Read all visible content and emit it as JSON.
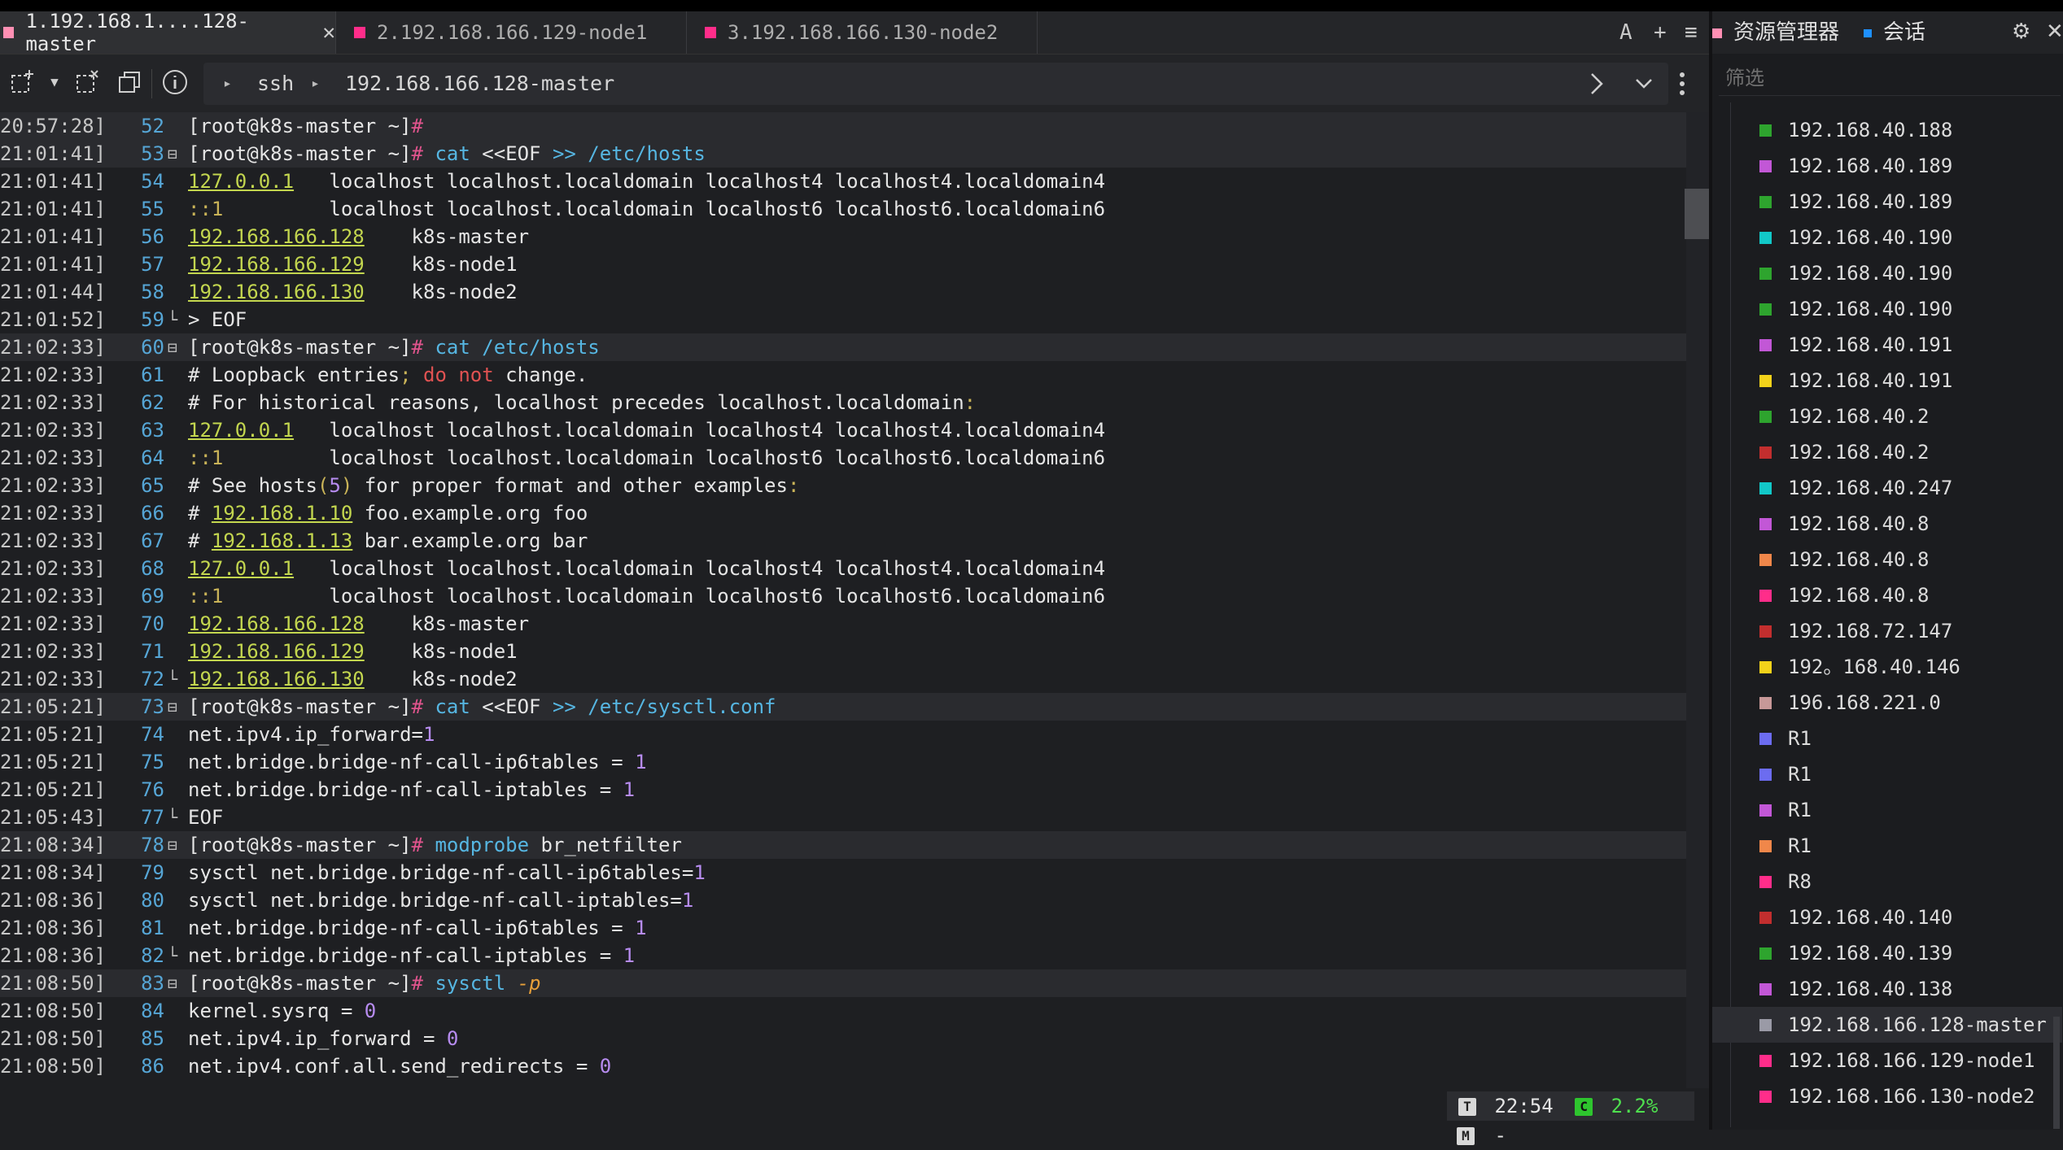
{
  "tabs": [
    {
      "label": "1.192.168.1....128-master",
      "color": "#ff8fb3",
      "active": true
    },
    {
      "label": "2.192.168.166.129-node1",
      "color": "#ff2d8a",
      "active": false
    },
    {
      "label": "3.192.168.166.130-node2",
      "color": "#ff2d8a",
      "active": false
    }
  ],
  "tabbar_tools": {
    "font": "A",
    "add": "+",
    "menu": "≡"
  },
  "breadcrumb": {
    "protocol": "ssh",
    "host": "192.168.166.128-master"
  },
  "terminal_lines": [
    {
      "ts": "20:57:28]",
      "n": "52",
      "fold": "",
      "hl": true,
      "segs": [
        [
          "[root@k8s-master ~]",
          "p"
        ],
        [
          "#",
          "h"
        ]
      ]
    },
    {
      "ts": "21:01:41]",
      "n": "53",
      "fold": "⊟",
      "hl": true,
      "segs": [
        [
          "[root@k8s-master ~]",
          "p"
        ],
        [
          "#",
          "h"
        ],
        [
          " cat ",
          "c"
        ],
        [
          "<<",
          "t"
        ],
        [
          "EOF ",
          "t"
        ],
        [
          ">>",
          "c"
        ],
        [
          " /etc/hosts",
          "c"
        ]
      ]
    },
    {
      "ts": "21:01:41]",
      "n": "54",
      "fold": "",
      "segs": [
        [
          "127.0.0.1",
          "ip"
        ],
        [
          "   localhost localhost.localdomain localhost4 localhost4.localdomain4",
          "t"
        ]
      ]
    },
    {
      "ts": "21:01:41]",
      "n": "55",
      "fold": "",
      "segs": [
        [
          "::1",
          "pu"
        ],
        [
          "         localhost localhost.localdomain localhost6 localhost6.localdomain6",
          "t"
        ]
      ]
    },
    {
      "ts": "21:01:41]",
      "n": "56",
      "fold": "",
      "segs": [
        [
          "192.168.166.128",
          "ip"
        ],
        [
          "    k8s-master",
          "t"
        ]
      ]
    },
    {
      "ts": "21:01:41]",
      "n": "57",
      "fold": "",
      "segs": [
        [
          "192.168.166.129",
          "ip"
        ],
        [
          "    k8s-node1",
          "t"
        ]
      ]
    },
    {
      "ts": "21:01:44]",
      "n": "58",
      "fold": "",
      "segs": [
        [
          "192.168.166.130",
          "ip"
        ],
        [
          "    k8s-node2",
          "t"
        ]
      ]
    },
    {
      "ts": "21:01:52]",
      "n": "59",
      "fold": "└",
      "segs": [
        [
          "> EOF",
          "t"
        ]
      ]
    },
    {
      "ts": "21:02:33]",
      "n": "60",
      "fold": "⊟",
      "hl": true,
      "segs": [
        [
          "[root@k8s-master ~]",
          "p"
        ],
        [
          "#",
          "h"
        ],
        [
          " cat /etc/hosts",
          "c"
        ]
      ]
    },
    {
      "ts": "21:02:33]",
      "n": "61",
      "fold": "",
      "segs": [
        [
          "# Loopback entries",
          "t"
        ],
        [
          ";",
          "pu"
        ],
        [
          " ",
          "t"
        ],
        [
          "do not",
          "r"
        ],
        [
          " change.",
          "t"
        ]
      ]
    },
    {
      "ts": "21:02:33]",
      "n": "62",
      "fold": "",
      "segs": [
        [
          "# For historical reasons, localhost precedes localhost.localdomain",
          "t"
        ],
        [
          ":",
          "pu"
        ]
      ]
    },
    {
      "ts": "21:02:33]",
      "n": "63",
      "fold": "",
      "segs": [
        [
          "127.0.0.1",
          "ip"
        ],
        [
          "   localhost localhost.localdomain localhost4 localhost4.localdomain4",
          "t"
        ]
      ]
    },
    {
      "ts": "21:02:33]",
      "n": "64",
      "fold": "",
      "segs": [
        [
          "::1",
          "pu"
        ],
        [
          "         localhost localhost.localdomain localhost6 localhost6.localdomain6",
          "t"
        ]
      ]
    },
    {
      "ts": "21:02:33]",
      "n": "65",
      "fold": "",
      "segs": [
        [
          "# See hosts",
          "t"
        ],
        [
          "(",
          "pu"
        ],
        [
          "5",
          "nm"
        ],
        [
          ")",
          "pu"
        ],
        [
          " for proper format and other examples",
          "t"
        ],
        [
          ":",
          "pu"
        ]
      ]
    },
    {
      "ts": "21:02:33]",
      "n": "66",
      "fold": "",
      "segs": [
        [
          "# ",
          "t"
        ],
        [
          "192.168.1.10",
          "ip"
        ],
        [
          " foo.example.org foo",
          "t"
        ]
      ]
    },
    {
      "ts": "21:02:33]",
      "n": "67",
      "fold": "",
      "segs": [
        [
          "# ",
          "t"
        ],
        [
          "192.168.1.13",
          "ip"
        ],
        [
          " bar.example.org bar",
          "t"
        ]
      ]
    },
    {
      "ts": "21:02:33]",
      "n": "68",
      "fold": "",
      "segs": [
        [
          "127.0.0.1",
          "ip"
        ],
        [
          "   localhost localhost.localdomain localhost4 localhost4.localdomain4",
          "t"
        ]
      ]
    },
    {
      "ts": "21:02:33]",
      "n": "69",
      "fold": "",
      "segs": [
        [
          "::1",
          "pu"
        ],
        [
          "         localhost localhost.localdomain localhost6 localhost6.localdomain6",
          "t"
        ]
      ]
    },
    {
      "ts": "21:02:33]",
      "n": "70",
      "fold": "",
      "segs": [
        [
          "192.168.166.128",
          "ip"
        ],
        [
          "    k8s-master",
          "t"
        ]
      ]
    },
    {
      "ts": "21:02:33]",
      "n": "71",
      "fold": "",
      "segs": [
        [
          "192.168.166.129",
          "ip"
        ],
        [
          "    k8s-node1",
          "t"
        ]
      ]
    },
    {
      "ts": "21:02:33]",
      "n": "72",
      "fold": "└",
      "segs": [
        [
          "192.168.166.130",
          "ip"
        ],
        [
          "    k8s-node2",
          "t"
        ]
      ]
    },
    {
      "ts": "21:05:21]",
      "n": "73",
      "fold": "⊟",
      "hl": true,
      "segs": [
        [
          "[root@k8s-master ~]",
          "p"
        ],
        [
          "#",
          "h"
        ],
        [
          " cat ",
          "c"
        ],
        [
          "<<",
          "t"
        ],
        [
          "EOF ",
          "t"
        ],
        [
          ">>",
          "c"
        ],
        [
          " /etc/sysctl.conf",
          "c"
        ]
      ]
    },
    {
      "ts": "21:05:21]",
      "n": "74",
      "fold": "",
      "segs": [
        [
          "net.ipv4.ip_forward=",
          "t"
        ],
        [
          "1",
          "nm"
        ]
      ]
    },
    {
      "ts": "21:05:21]",
      "n": "75",
      "fold": "",
      "segs": [
        [
          "net.bridge.bridge-nf-call-ip6tables = ",
          "t"
        ],
        [
          "1",
          "nm"
        ]
      ]
    },
    {
      "ts": "21:05:21]",
      "n": "76",
      "fold": "",
      "segs": [
        [
          "net.bridge.bridge-nf-call-iptables = ",
          "t"
        ],
        [
          "1",
          "nm"
        ]
      ]
    },
    {
      "ts": "21:05:43]",
      "n": "77",
      "fold": "└",
      "segs": [
        [
          "EOF",
          "t"
        ]
      ]
    },
    {
      "ts": "21:08:34]",
      "n": "78",
      "fold": "⊟",
      "hl": true,
      "segs": [
        [
          "[root@k8s-master ~]",
          "p"
        ],
        [
          "#",
          "h"
        ],
        [
          " modprobe ",
          "c"
        ],
        [
          "br_netfilter",
          "t"
        ]
      ]
    },
    {
      "ts": "21:08:34]",
      "n": "79",
      "fold": "",
      "segs": [
        [
          "sysctl net.bridge.bridge-nf-call-ip6tables=",
          "t"
        ],
        [
          "1",
          "nm"
        ]
      ]
    },
    {
      "ts": "21:08:36]",
      "n": "80",
      "fold": "",
      "segs": [
        [
          "sysctl net.bridge.bridge-nf-call-iptables=",
          "t"
        ],
        [
          "1",
          "nm"
        ]
      ]
    },
    {
      "ts": "21:08:36]",
      "n": "81",
      "fold": "",
      "segs": [
        [
          "net.bridge.bridge-nf-call-ip6tables = ",
          "t"
        ],
        [
          "1",
          "nm"
        ]
      ]
    },
    {
      "ts": "21:08:36]",
      "n": "82",
      "fold": "└",
      "segs": [
        [
          "net.bridge.bridge-nf-call-iptables = ",
          "t"
        ],
        [
          "1",
          "nm"
        ]
      ]
    },
    {
      "ts": "21:08:50]",
      "n": "83",
      "fold": "⊟",
      "hl": true,
      "segs": [
        [
          "[root@k8s-master ~]",
          "p"
        ],
        [
          "#",
          "h"
        ],
        [
          " sysctl ",
          "c"
        ],
        [
          "-p",
          "o"
        ]
      ]
    },
    {
      "ts": "21:08:50]",
      "n": "84",
      "fold": "",
      "segs": [
        [
          "kernel.sysrq = ",
          "t"
        ],
        [
          "0",
          "nm"
        ]
      ]
    },
    {
      "ts": "21:08:50]",
      "n": "85",
      "fold": "",
      "segs": [
        [
          "net.ipv4.ip_forward = ",
          "t"
        ],
        [
          "0",
          "nm"
        ]
      ]
    },
    {
      "ts": "21:08:50]",
      "n": "86",
      "fold": "",
      "segs": [
        [
          "net.ipv4.conf.all.send_redirects = ",
          "t"
        ],
        [
          "0",
          "nm"
        ]
      ]
    }
  ],
  "status": {
    "t_label": "T",
    "time": "22:54",
    "c_label": "C",
    "cpu": "2.2%",
    "m_label": "M",
    "mem": "-"
  },
  "side": {
    "tab_explorer": "资源管理器",
    "tab_session": "会话",
    "explorer_color": "#ff8fb3",
    "session_color": "#1e90ff",
    "filter_placeholder": "筛选",
    "items": [
      {
        "label": "192.168.40.188",
        "color": "#2ea42e"
      },
      {
        "label": "192.168.40.189",
        "color": "#c257d6"
      },
      {
        "label": "192.168.40.189",
        "color": "#2ea42e"
      },
      {
        "label": "192.168.40.190",
        "color": "#12c8c8"
      },
      {
        "label": "192.168.40.190",
        "color": "#2ea42e"
      },
      {
        "label": "192.168.40.190",
        "color": "#2ea42e"
      },
      {
        "label": "192.168.40.191",
        "color": "#c257d6"
      },
      {
        "label": "192.168.40.191",
        "color": "#f2d21a"
      },
      {
        "label": "192.168.40.2",
        "color": "#2ea42e"
      },
      {
        "label": "192.168.40.2",
        "color": "#c22e2e"
      },
      {
        "label": "192.168.40.247",
        "color": "#12c8c8"
      },
      {
        "label": "192.168.40.8",
        "color": "#c257d6"
      },
      {
        "label": "192.168.40.8",
        "color": "#f0874a"
      },
      {
        "label": "192.168.40.8",
        "color": "#ff2d8a"
      },
      {
        "label": "192.168.72.147",
        "color": "#c22e2e"
      },
      {
        "label": "192。168.40.146",
        "color": "#f2d21a"
      },
      {
        "label": "196.168.221.0",
        "color": "#c79898"
      },
      {
        "label": "R1",
        "color": "#6c6cf0"
      },
      {
        "label": "R1",
        "color": "#6c6cf0"
      },
      {
        "label": "R1",
        "color": "#c257d6"
      },
      {
        "label": "R1",
        "color": "#f0874a"
      },
      {
        "label": "R8",
        "color": "#ff2d8a"
      },
      {
        "label": "192.168.40.140",
        "color": "#c22e2e"
      },
      {
        "label": "192.168.40.139",
        "color": "#2ea42e"
      },
      {
        "label": "192.168.40.138",
        "color": "#c257d6"
      },
      {
        "label": "192.168.166.128-master",
        "color": "#9a9aa6",
        "selected": true
      },
      {
        "label": "192.168.166.129-node1",
        "color": "#ff2d8a"
      },
      {
        "label": "192.168.166.130-node2",
        "color": "#ff2d8a"
      }
    ]
  }
}
